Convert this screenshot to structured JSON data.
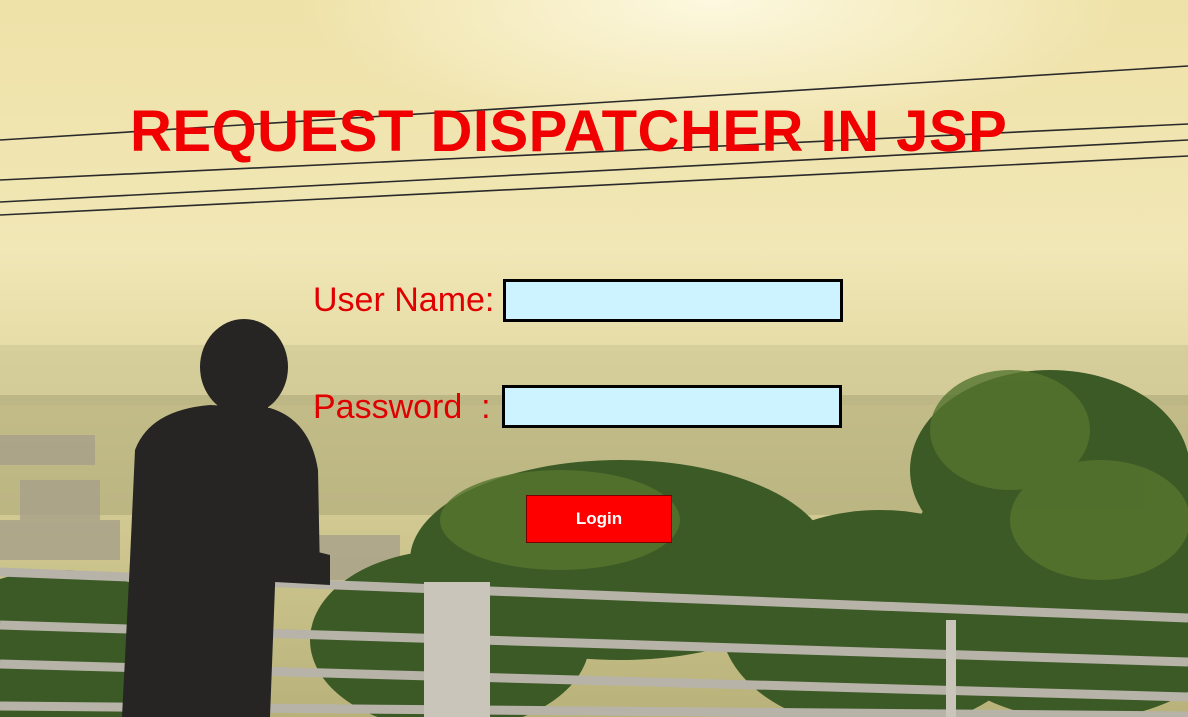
{
  "page": {
    "title": "REQUEST DISPATCHER IN JSP"
  },
  "form": {
    "username_label": "User Name:",
    "password_label": "Password  :",
    "username_value": "",
    "password_value": "",
    "login_label": "Login"
  },
  "colors": {
    "title": "#f00000",
    "label": "#e00000",
    "input_bg": "#ccf3ff",
    "button_bg": "#ff0000",
    "button_text": "#ffffff"
  }
}
